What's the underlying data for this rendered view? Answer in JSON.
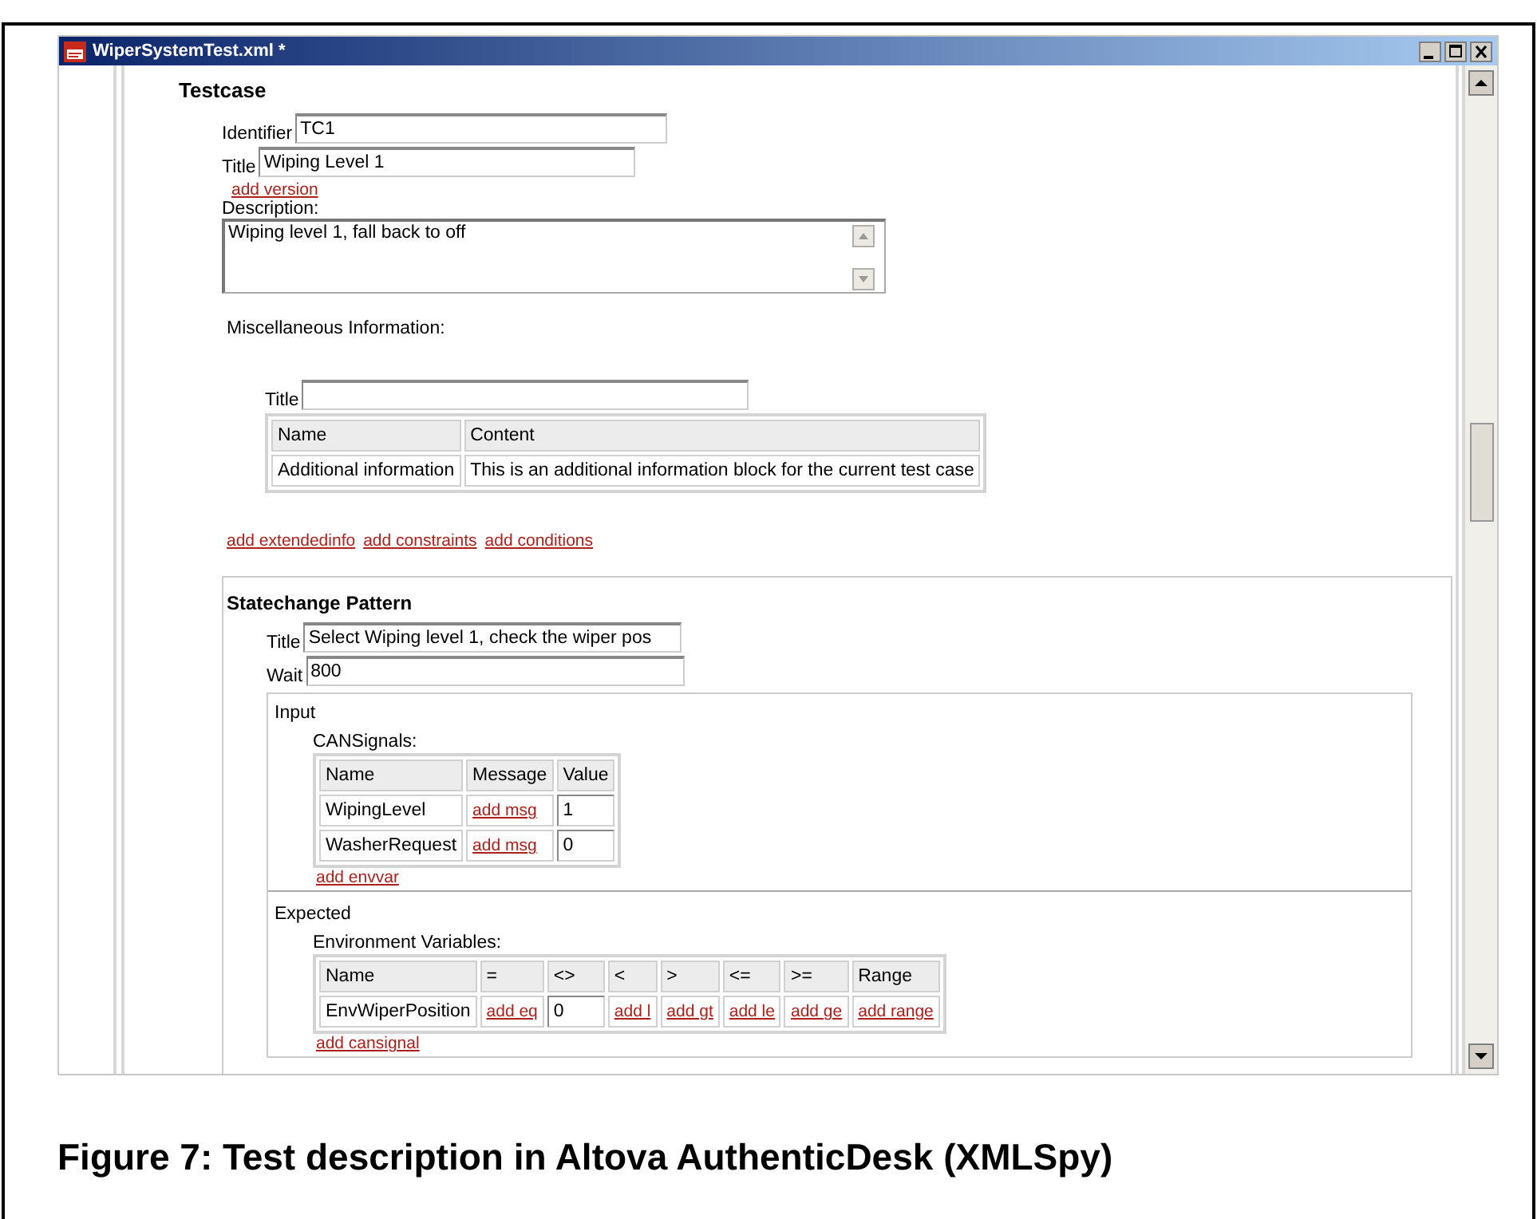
{
  "window": {
    "title": "WiperSystemTest.xml *"
  },
  "testcase": {
    "heading": "Testcase",
    "fields": [
      {
        "label": "Identifier",
        "value": "TC1"
      },
      {
        "label": "Title",
        "value": "Wiping Level 1"
      }
    ],
    "add_version_link": "add version",
    "description_label": "Description:",
    "description": "Wiping level 1, fall back to off",
    "misc": {
      "label": "Miscellaneous Information:",
      "title_label": "Title",
      "table": {
        "columns": [
          "Name",
          "Content"
        ],
        "rows": [
          {
            "cells": [
              {
                "kind": "text",
                "text": "Additional information"
              },
              {
                "kind": "text",
                "text": "This is an additional information block for the current test case"
              }
            ]
          }
        ]
      }
    },
    "links": [
      "add extendedinfo",
      "add constraints",
      "add conditions"
    ]
  },
  "statechange": {
    "heading": "Statechange Pattern",
    "fields": [
      {
        "label": "Title",
        "value": "Select Wiping level 1, check the wiper pos"
      },
      {
        "label": "Wait",
        "value": "800"
      }
    ],
    "input": {
      "label": "Input",
      "table_label": "CANSignals:",
      "table": {
        "columns": [
          "Name",
          "Message",
          "Value"
        ],
        "rows": [
          {
            "cells": [
              {
                "kind": "text",
                "text": "WipingLevel"
              },
              {
                "kind": "link",
                "text": "add msg"
              },
              {
                "kind": "field",
                "text": "1"
              }
            ]
          },
          {
            "cells": [
              {
                "kind": "text",
                "text": "WasherRequest"
              },
              {
                "kind": "link",
                "text": "add msg"
              },
              {
                "kind": "field",
                "text": "0"
              }
            ]
          }
        ]
      },
      "link": "add envvar"
    },
    "expected": {
      "label": "Expected",
      "table_label": "Environment Variables:",
      "table": {
        "columns": [
          "Name",
          "=",
          "<>",
          "<",
          ">",
          "<=",
          ">=",
          "Range"
        ],
        "rows": [
          {
            "cells": [
              {
                "kind": "text",
                "text": "EnvWiperPosition"
              },
              {
                "kind": "link",
                "text": "add eq"
              },
              {
                "kind": "field",
                "text": "0"
              },
              {
                "kind": "link",
                "text": "add l"
              },
              {
                "kind": "link",
                "text": "add gt"
              },
              {
                "kind": "link",
                "text": "add le"
              },
              {
                "kind": "link",
                "text": "add ge"
              },
              {
                "kind": "link",
                "text": "add range"
              }
            ]
          }
        ]
      },
      "link": "add cansignal"
    }
  },
  "caption": "Figure 7: Test description in Altova AuthenticDesk (XMLSpy)"
}
